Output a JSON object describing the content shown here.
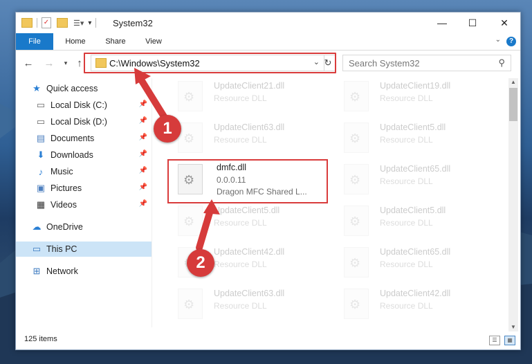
{
  "window": {
    "title": "System32",
    "controls": {
      "minimize": "—",
      "maximize": "☐",
      "close": "✕"
    }
  },
  "ribbon": {
    "tabs": [
      "File",
      "Home",
      "Share",
      "View"
    ],
    "help": "?"
  },
  "nav": {
    "address": "C:\\Windows\\System32",
    "search_placeholder": "Search System32"
  },
  "sidebar": {
    "items": [
      {
        "label": "Quick access",
        "icon": "star-icon",
        "pinned": false
      },
      {
        "label": "Local Disk (C:)",
        "icon": "drive-icon",
        "pinned": true
      },
      {
        "label": "Local Disk (D:)",
        "icon": "drive-icon",
        "pinned": true
      },
      {
        "label": "Documents",
        "icon": "documents-icon",
        "pinned": true
      },
      {
        "label": "Downloads",
        "icon": "downloads-icon",
        "pinned": true
      },
      {
        "label": "Music",
        "icon": "music-icon",
        "pinned": true
      },
      {
        "label": "Pictures",
        "icon": "pictures-icon",
        "pinned": true
      },
      {
        "label": "Videos",
        "icon": "videos-icon",
        "pinned": true
      },
      {
        "label": "OneDrive",
        "icon": "cloud-icon",
        "pinned": false
      },
      {
        "label": "This PC",
        "icon": "computer-icon",
        "pinned": false
      },
      {
        "label": "Network",
        "icon": "network-icon",
        "pinned": false
      }
    ],
    "selected": "This PC"
  },
  "files": {
    "left_column": [
      {
        "name": "UpdateClient21.dll",
        "desc": "Resource DLL"
      },
      {
        "name": "UpdateClient63.dll",
        "desc": "Resource DLL"
      },
      {
        "name": "dmfc.dll",
        "desc": "0.0.0.11",
        "line3": "Dragon MFC Shared L..."
      },
      {
        "name": "UpdateClient5.dll",
        "desc": "Resource DLL"
      },
      {
        "name": "UpdateClient42.dll",
        "desc": "Resource DLL"
      },
      {
        "name": "UpdateClient63.dll",
        "desc": "Resource DLL"
      }
    ],
    "right_column": [
      {
        "name": "UpdateClient19.dll",
        "desc": "Resource DLL"
      },
      {
        "name": "UpdateClient5.dll",
        "desc": "Resource DLL"
      },
      {
        "name": "UpdateClient65.dll",
        "desc": "Resource DLL"
      },
      {
        "name": "UpdateClient5.dll",
        "desc": "Resource DLL"
      },
      {
        "name": "UpdateClient65.dll",
        "desc": "Resource DLL"
      },
      {
        "name": "UpdateClient42.dll",
        "desc": "Resource DLL"
      }
    ]
  },
  "status": {
    "item_count": "125 items"
  },
  "annotations": {
    "step1": "1",
    "step2": "2",
    "color": "#d63b3b"
  }
}
